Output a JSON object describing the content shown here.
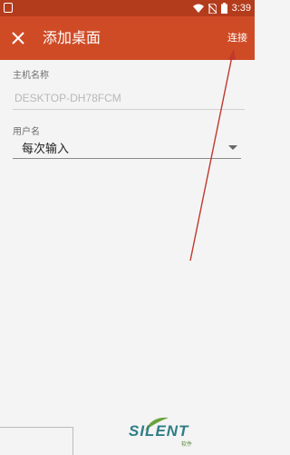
{
  "status_bar": {
    "time": "3:39",
    "icons": [
      "app-icon",
      "wifi-icon",
      "no-sim-icon",
      "battery-icon"
    ]
  },
  "app_bar": {
    "title": "添加桌面",
    "close_icon": "close-icon",
    "connect_label": "连接"
  },
  "form": {
    "host_label": "主机名称",
    "host_placeholder": "DESKTOP-DH78FCM",
    "user_label": "用户名",
    "user_selected": "每次输入"
  },
  "watermark": {
    "text": "SILENT",
    "sub": "软件"
  },
  "colors": {
    "status_bar": "#b33c1d",
    "app_bar": "#cf4b26",
    "annotation_arrow": "#c0392b",
    "background": "#f4f4f4"
  }
}
